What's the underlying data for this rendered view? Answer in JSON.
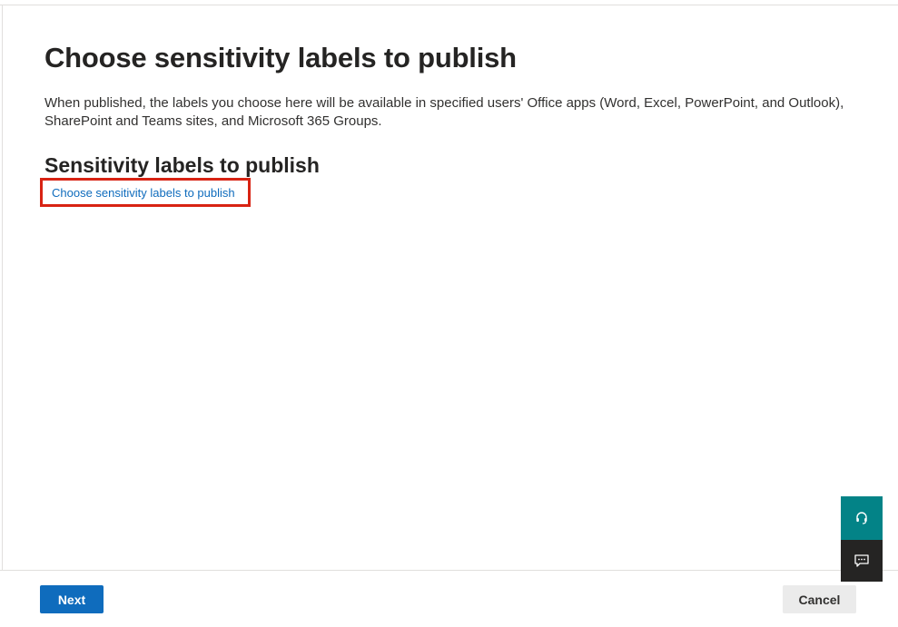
{
  "page": {
    "title": "Choose sensitivity labels to publish",
    "description": "When published, the labels you choose here will be available in specified users' Office apps (Word, Excel, PowerPoint, and Outlook), SharePoint and Teams sites, and Microsoft 365 Groups.",
    "section_heading": "Sensitivity labels to publish",
    "choose_link": "Choose sensitivity labels to publish"
  },
  "footer": {
    "next_label": "Next",
    "cancel_label": "Cancel"
  },
  "side_tools": {
    "help_icon": "headset-icon",
    "feedback_icon": "chat-feedback-icon"
  },
  "colors": {
    "accent": "#0f6cbd",
    "highlight": "#d82313",
    "help_bg": "#038387",
    "feedback_bg": "#252423"
  }
}
